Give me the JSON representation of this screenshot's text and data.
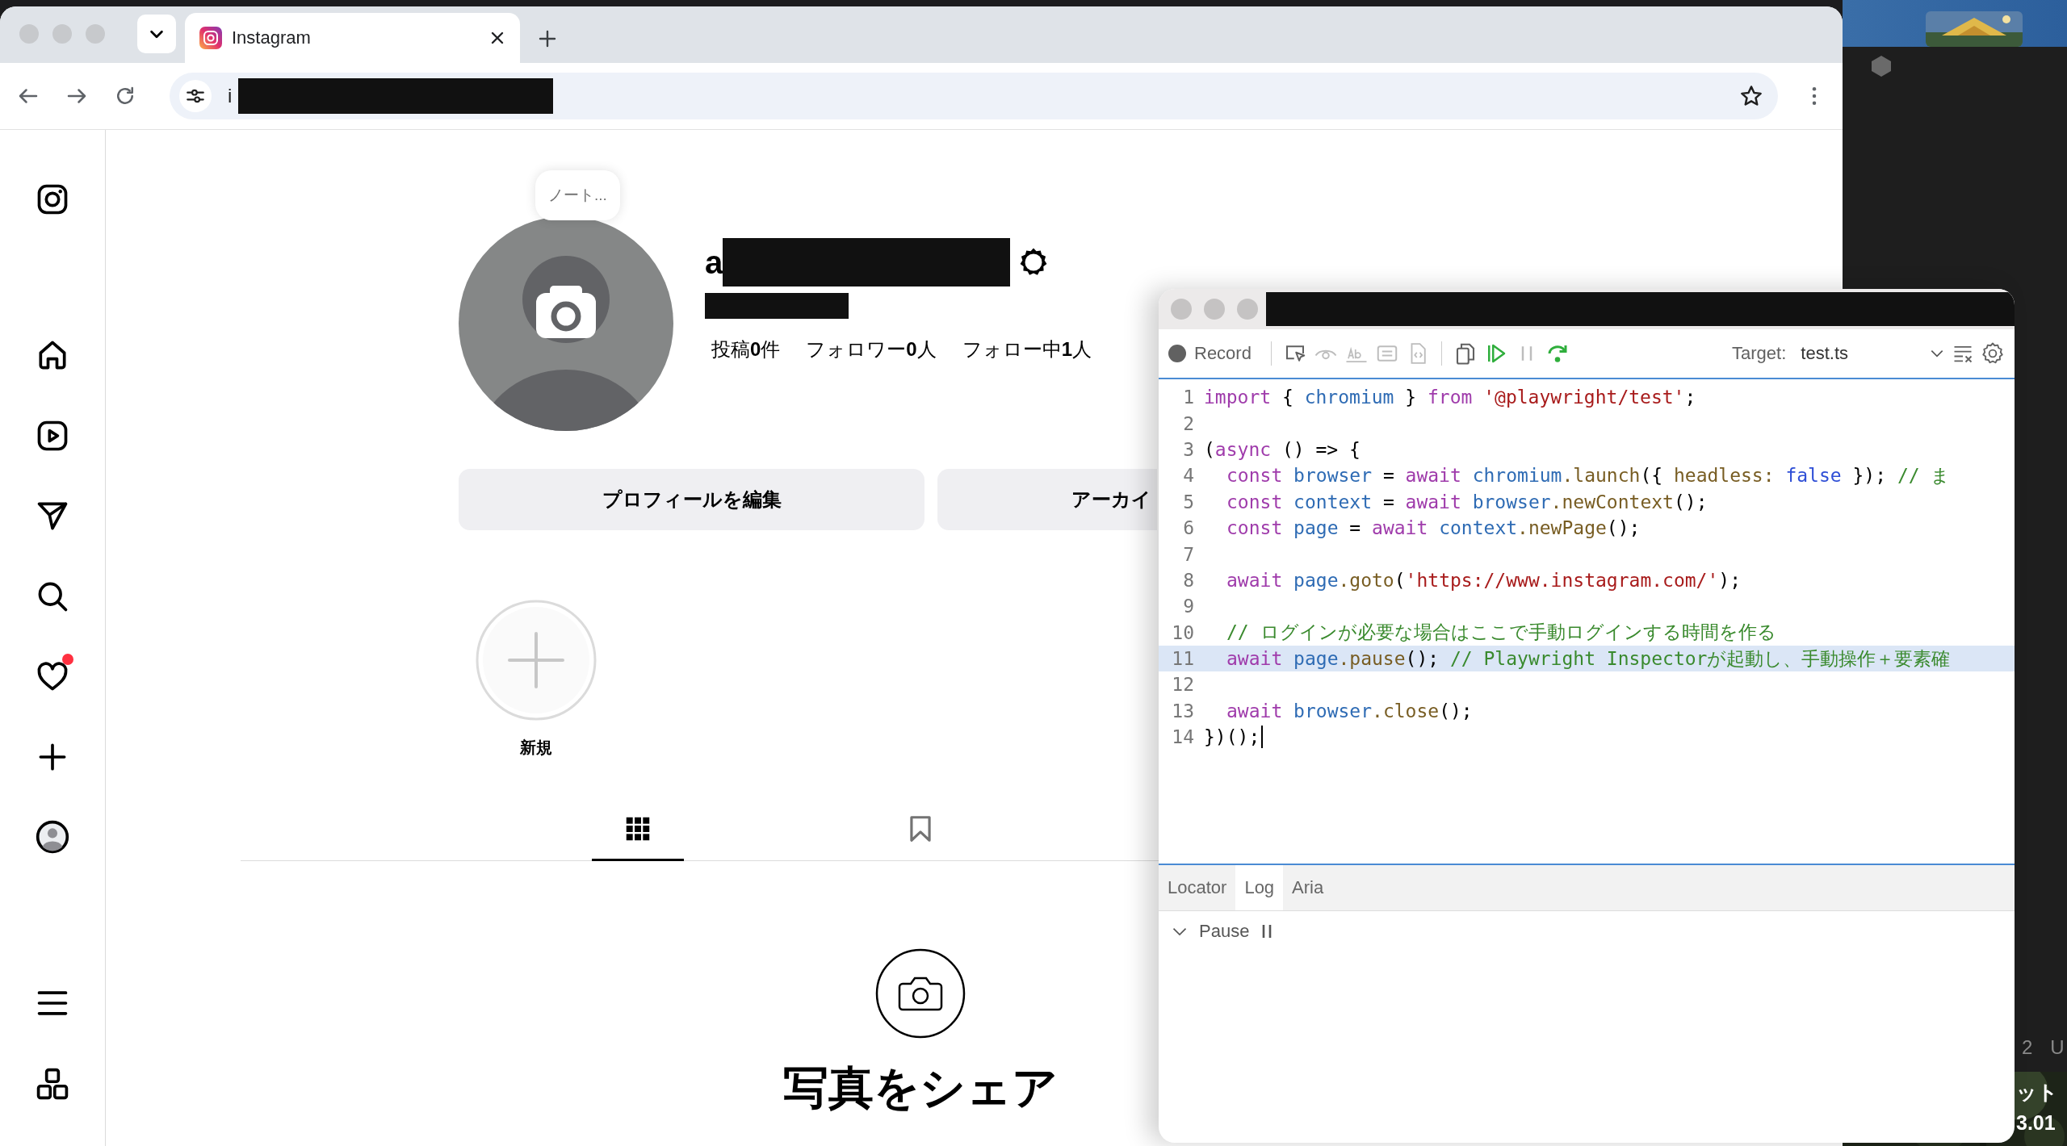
{
  "browser": {
    "tab": {
      "title": "Instagram"
    },
    "address": {
      "value": "i"
    }
  },
  "sidebar": {
    "items": [
      {
        "kind": "logo",
        "notification": false
      },
      {
        "kind": "home",
        "notification": false
      },
      {
        "kind": "reels",
        "notification": false
      },
      {
        "kind": "messages",
        "notification": false
      },
      {
        "kind": "search",
        "notification": false
      },
      {
        "kind": "notifications",
        "notification": true
      },
      {
        "kind": "create",
        "notification": false
      },
      {
        "kind": "profile",
        "notification": false
      }
    ],
    "bottom_items": [
      {
        "kind": "menu"
      },
      {
        "kind": "more"
      }
    ]
  },
  "profile": {
    "note": "ノート...",
    "username_initial": "a",
    "stats": [
      "投稿**0**件",
      "フォロワー**0**人",
      "フォロー中**1**人"
    ],
    "buttons": [
      "プロフィールを編集",
      "アーカイ"
    ],
    "highlight": {
      "label": "新規"
    },
    "tabs": [
      {
        "kind": "grid",
        "selected": true
      },
      {
        "kind": "saved",
        "selected": false
      }
    ],
    "empty_state": {
      "title": "写真をシェア"
    }
  },
  "inspector": {
    "toolbar": {
      "record_label": "Record",
      "tools": [
        {
          "kind": "pick",
          "disabled": false
        },
        {
          "kind": "eye",
          "disabled": true
        },
        {
          "kind": "text",
          "disabled": true
        },
        {
          "kind": "list",
          "disabled": true
        },
        {
          "kind": "code",
          "disabled": true
        },
        {
          "kind": "copy",
          "disabled": false
        },
        {
          "kind": "resume",
          "disabled": false
        },
        {
          "kind": "pause",
          "disabled": true
        },
        {
          "kind": "step",
          "disabled": false
        }
      ],
      "target_label": "Target:",
      "target_value": "test.ts"
    },
    "code": {
      "lines": [
        {
          "number": "1",
          "indented": false,
          "highlighted": false,
          "cursor": false,
          "tokens": [
            {
              "kind": "keyword",
              "text": "import "
            },
            {
              "kind": "plain",
              "text": "{ "
            },
            {
              "kind": "variable",
              "text": "chromium "
            },
            {
              "kind": "plain",
              "text": "} "
            },
            {
              "kind": "keyword",
              "text": "from "
            },
            {
              "kind": "string",
              "text": "'@playwright/test'"
            },
            {
              "kind": "plain",
              "text": ";"
            }
          ]
        },
        {
          "number": "2",
          "highlighted": false,
          "cursor": false
        },
        {
          "number": "3",
          "indented": false,
          "highlighted": false,
          "cursor": false,
          "tokens": [
            {
              "kind": "plain",
              "text": "("
            },
            {
              "kind": "keyword",
              "text": "async "
            },
            {
              "kind": "plain",
              "text": "() => {"
            }
          ]
        },
        {
          "number": "4",
          "indented": true,
          "highlighted": false,
          "cursor": false,
          "tokens": [
            {
              "kind": "keyword",
              "text": "const "
            },
            {
              "kind": "variable",
              "text": "browser "
            },
            {
              "kind": "plain",
              "text": "= "
            },
            {
              "kind": "keyword",
              "text": "await "
            },
            {
              "kind": "variable",
              "text": "chromium"
            },
            {
              "kind": "function",
              "text": ".launch"
            },
            {
              "kind": "plain",
              "text": "({ "
            },
            {
              "kind": "function",
              "text": "headless: "
            },
            {
              "kind": "literal",
              "text": "false "
            },
            {
              "kind": "plain",
              "text": "}); "
            },
            {
              "kind": "comment",
              "text": "// ま"
            }
          ]
        },
        {
          "number": "5",
          "indented": true,
          "highlighted": false,
          "cursor": false,
          "tokens": [
            {
              "kind": "keyword",
              "text": "const "
            },
            {
              "kind": "variable",
              "text": "context "
            },
            {
              "kind": "plain",
              "text": "= "
            },
            {
              "kind": "keyword",
              "text": "await "
            },
            {
              "kind": "variable",
              "text": "browser"
            },
            {
              "kind": "function",
              "text": ".newContext"
            },
            {
              "kind": "plain",
              "text": "();"
            }
          ]
        },
        {
          "number": "6",
          "indented": true,
          "highlighted": false,
          "cursor": false,
          "tokens": [
            {
              "kind": "keyword",
              "text": "const "
            },
            {
              "kind": "variable",
              "text": "page "
            },
            {
              "kind": "plain",
              "text": "= "
            },
            {
              "kind": "keyword",
              "text": "await "
            },
            {
              "kind": "variable",
              "text": "context"
            },
            {
              "kind": "function",
              "text": ".newPage"
            },
            {
              "kind": "plain",
              "text": "();"
            }
          ]
        },
        {
          "number": "7",
          "highlighted": false,
          "cursor": false
        },
        {
          "number": "8",
          "indented": true,
          "highlighted": false,
          "cursor": false,
          "tokens": [
            {
              "kind": "keyword",
              "text": "await "
            },
            {
              "kind": "variable",
              "text": "page"
            },
            {
              "kind": "function",
              "text": ".goto"
            },
            {
              "kind": "plain",
              "text": "("
            },
            {
              "kind": "string",
              "text": "'https://www.instagram.com/'"
            },
            {
              "kind": "plain",
              "text": ");"
            }
          ]
        },
        {
          "number": "9",
          "highlighted": false,
          "cursor": false
        },
        {
          "number": "10",
          "indented": true,
          "highlighted": false,
          "cursor": false,
          "tokens": [
            {
              "kind": "comment",
              "text": "// ログインが必要な場合はここで手動ログインする時間を作る"
            }
          ]
        },
        {
          "number": "11",
          "indented": true,
          "highlighted": true,
          "cursor": false,
          "tokens": [
            {
              "kind": "keyword",
              "text": "await "
            },
            {
              "kind": "variable",
              "text": "page"
            },
            {
              "kind": "function",
              "text": ".pause"
            },
            {
              "kind": "plain",
              "text": "(); "
            },
            {
              "kind": "comment",
              "text": "// Playwright Inspectorが起動し、手動操作＋要素確"
            }
          ]
        },
        {
          "number": "12",
          "highlighted": false,
          "cursor": false
        },
        {
          "number": "13",
          "indented": true,
          "highlighted": false,
          "cursor": false,
          "tokens": [
            {
              "kind": "keyword",
              "text": "await "
            },
            {
              "kind": "variable",
              "text": "browser"
            },
            {
              "kind": "function",
              "text": ".close"
            },
            {
              "kind": "plain",
              "text": "();"
            }
          ]
        },
        {
          "number": "14",
          "indented": false,
          "highlighted": false,
          "cursor": true,
          "tokens": [
            {
              "kind": "plain",
              "text": "})();"
            }
          ]
        }
      ]
    },
    "panel_tabs": [
      {
        "label": "Locator",
        "selected": false
      },
      {
        "label": "Log",
        "selected": true
      },
      {
        "label": "Aria",
        "selected": false
      }
    ],
    "log": [
      {
        "label": "Pause",
        "expanded": true
      }
    ]
  },
  "background_app": {
    "texts": [
      "2",
      "U",
      "ット",
      "3.01"
    ]
  }
}
